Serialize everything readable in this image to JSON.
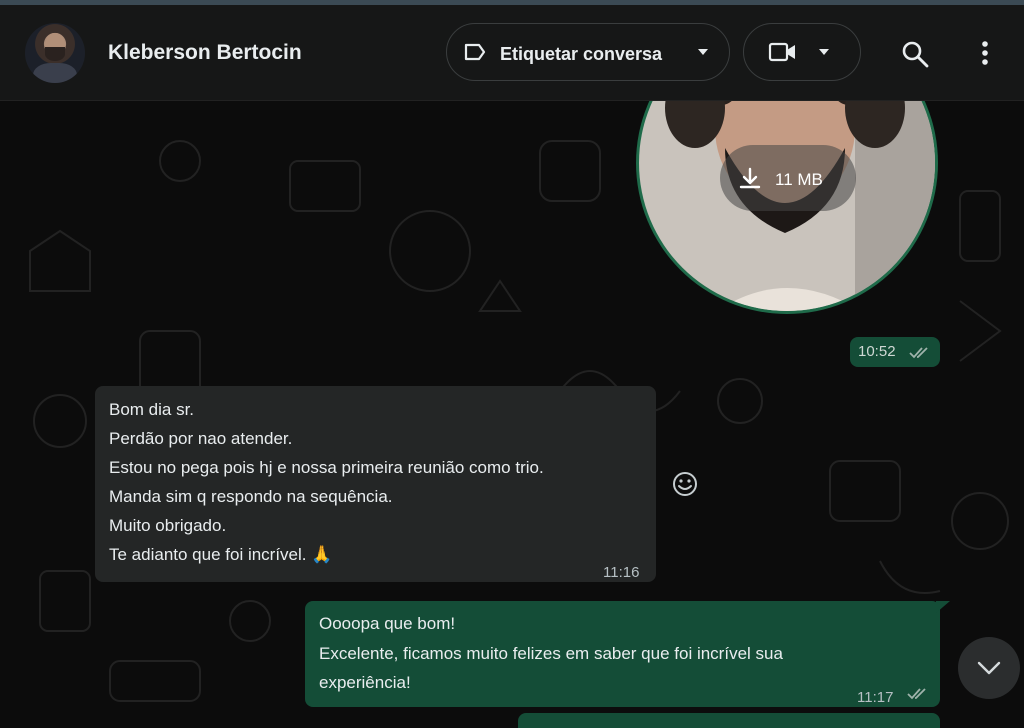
{
  "header": {
    "contact_name": "Kleberson Bertocin",
    "label_button": "Etiquetar conversa",
    "icons": [
      "label-icon",
      "chevron-down-icon",
      "video-call-icon",
      "chevron-down-icon",
      "search-icon",
      "more-vertical-icon"
    ]
  },
  "media": {
    "download_size": "11 MB",
    "time": "10:52"
  },
  "messages": [
    {
      "direction": "incoming",
      "lines": [
        "Bom dia sr.",
        "Perdão por nao atender.",
        "Estou no pega pois hj e nossa primeira reunião como trio.",
        "Manda sim q respondo na sequência.",
        "Muito obrigado.",
        "Te adianto que foi incrível. 🙏"
      ],
      "time": "11:16"
    },
    {
      "direction": "outgoing",
      "lines": [
        "Oooopa que bom!",
        "Excelente, ficamos muito felizes em saber que foi incrível sua",
        "experiência!"
      ],
      "time": "11:17"
    }
  ],
  "colors": {
    "header_bg": "#161717",
    "incoming_bg": "#242626",
    "outgoing_bg": "#144d37",
    "accent_green": "#1f6b4a"
  }
}
